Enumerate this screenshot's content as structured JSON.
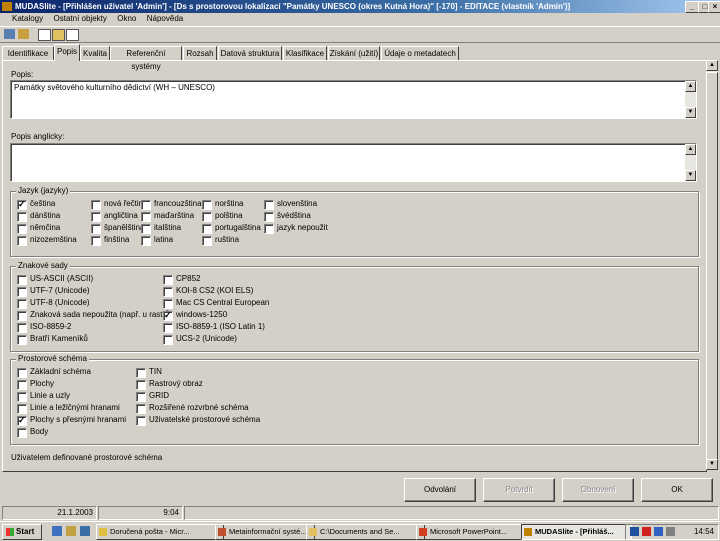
{
  "window": {
    "title": "MUDASlite - [Přihlášen uživatel 'Admin'] - [Ds s prostorovou lokalizací \"Památky UNESCO (okres Kutná Hora)\" [-170] - EDITACE (vlastník 'Admin')]",
    "controls": [
      "_",
      "□",
      "×"
    ]
  },
  "menu": [
    "Katalogy",
    "Ostatní objekty",
    "Okno",
    "Nápověda"
  ],
  "tabs": [
    "Identifikace",
    "Popis",
    "Kvalita",
    "Referenční systémy",
    "Rozsah",
    "Datová struktura",
    "Klasifikace",
    "Získání (užití)",
    "Údaje o metadatech"
  ],
  "active_tab": 1,
  "fields": {
    "popis_label": "Popis:",
    "popis_value": "Památky světového kulturního dědictví (WH – UNESCO)",
    "popis_en_label": "Popis anglicky:",
    "popis_en_value": ""
  },
  "languages": {
    "title": "Jazyk (jazyky)",
    "items": [
      {
        "label": "čeština",
        "checked": true
      },
      {
        "label": "dánština",
        "checked": false
      },
      {
        "label": "němčina",
        "checked": false
      },
      {
        "label": "nizozemština",
        "checked": false
      },
      {
        "label": "nová řečtina",
        "checked": false
      },
      {
        "label": "angličtina",
        "checked": false
      },
      {
        "label": "španělština",
        "checked": false
      },
      {
        "label": "finština",
        "checked": false
      },
      {
        "label": "francouzština",
        "checked": false
      },
      {
        "label": "maďarština",
        "checked": false
      },
      {
        "label": "italština",
        "checked": false
      },
      {
        "label": "latina",
        "checked": false
      },
      {
        "label": "norština",
        "checked": false
      },
      {
        "label": "polština",
        "checked": false
      },
      {
        "label": "portugalština",
        "checked": false
      },
      {
        "label": "ruština",
        "checked": false
      },
      {
        "label": "slovenština",
        "checked": false
      },
      {
        "label": "švédština",
        "checked": false
      },
      {
        "label": "jazyk nepoužit",
        "checked": false
      }
    ]
  },
  "charsets": {
    "title": "Znakové sady",
    "items": [
      {
        "label": "US-ASCII (ASCII)",
        "checked": false
      },
      {
        "label": "UTF-7 (Unicode)",
        "checked": false
      },
      {
        "label": "UTF-8 (Unicode)",
        "checked": false
      },
      {
        "label": "Znaková sada nepoužita (např. u rastrů)",
        "checked": false
      },
      {
        "label": "ISO-8859-2",
        "checked": false
      },
      {
        "label": "Bratří Kameníků",
        "checked": false
      },
      {
        "label": "CP852",
        "checked": false
      },
      {
        "label": "KOI-8 CS2 (KOI ELS)",
        "checked": false
      },
      {
        "label": "Mac CS Central European",
        "checked": false
      },
      {
        "label": "windows-1250",
        "checked": true
      },
      {
        "label": "ISO-8859-1 (ISO Latin 1)",
        "checked": false
      },
      {
        "label": "UCS-2 (Unicode)",
        "checked": false
      }
    ]
  },
  "representation": {
    "title": "Prostorové schéma",
    "items": [
      {
        "label": "Základní schéma",
        "checked": false
      },
      {
        "label": "Plochy",
        "checked": false
      },
      {
        "label": "Linie a uzly",
        "checked": false
      },
      {
        "label": "Linie a ležlčnými hranami",
        "checked": false
      },
      {
        "label": "Plochy s přesnými hranami",
        "checked": true
      },
      {
        "label": "Body",
        "checked": false
      },
      {
        "label": "TIN",
        "checked": false
      },
      {
        "label": "Rastrový obraz",
        "checked": false
      },
      {
        "label": "GRID",
        "checked": false
      },
      {
        "label": "Rozšiřené rozvrbné schéma",
        "checked": false
      },
      {
        "label": "Uživatelské prostorové schéma",
        "checked": false
      }
    ],
    "extra_label": "Uživatelem definované prostorové schéma"
  },
  "buttons": {
    "cancel": "Odvolání",
    "restore": "Potvrdit",
    "save": "Obnovení",
    "ok": "OK"
  },
  "status": {
    "date": "21.1.2003",
    "time": "9:04"
  },
  "taskbar": {
    "start": "Start",
    "tasks": [
      "Doručená pošta - Micr...",
      "Metainformační systé...",
      "C:\\Documents and Se...",
      "Microsoft PowerPoint...",
      "MUDASlite - [Přihláš..."
    ],
    "active_task": 4,
    "clock": "14:54"
  },
  "colors": {
    "titlebar_start": "#0a246a",
    "titlebar_end": "#a6caf0",
    "window_bg": "#d4d0c8"
  }
}
